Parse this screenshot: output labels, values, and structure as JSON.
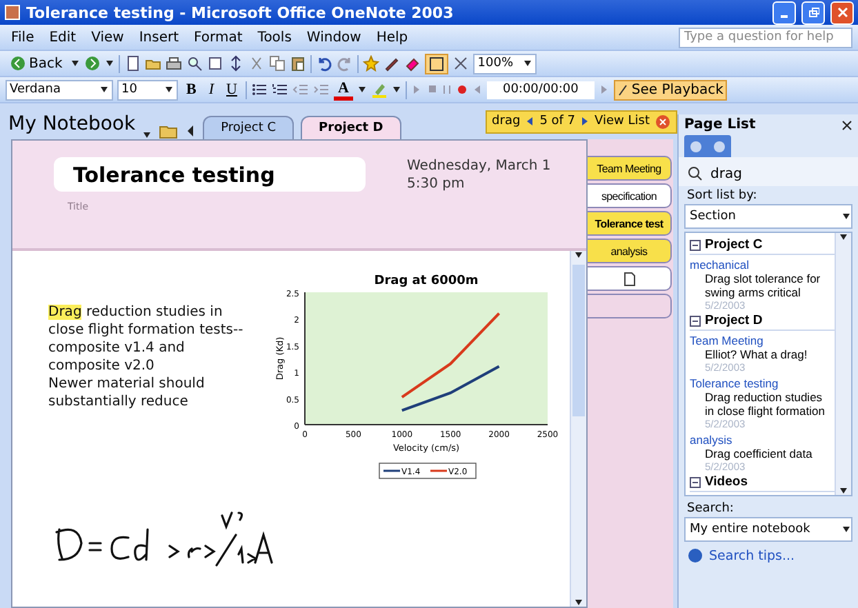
{
  "window": {
    "title": "Tolerance testing - Microsoft Office OneNote 2003"
  },
  "menu": [
    "File",
    "Edit",
    "View",
    "Insert",
    "Format",
    "Tools",
    "Window",
    "Help"
  ],
  "help_search": {
    "placeholder": "Type a question for help"
  },
  "standard_toolbar": {
    "back": "Back",
    "zoom": "100%"
  },
  "formatting_toolbar": {
    "font": "Verdana",
    "size": "10",
    "bold": "B",
    "italic": "I",
    "underline": "U",
    "font_color": "A"
  },
  "audio_toolbar": {
    "time": "00:00/00:00",
    "playback": "See Playback"
  },
  "notebook": {
    "title": "My Notebook"
  },
  "section_tabs": [
    {
      "label": "Project C",
      "selected": false
    },
    {
      "label": "Project D",
      "selected": true
    }
  ],
  "search_bar": {
    "term": "drag",
    "position": "5 of 7",
    "view_list": "View List"
  },
  "page": {
    "title": "Tolerance testing",
    "title_label": "Title",
    "date": "Wednesday, March 1",
    "time": "5:30 pm",
    "paragraphs": [
      {
        "highlight": "Drag",
        "text": " reduction studies in close flight formation tests--composite v1.4 and composite v2.0"
      },
      {
        "text": "Newer material should substantially reduce"
      }
    ],
    "chart_data": {
      "type": "line",
      "title": "Drag at 6000m",
      "xlabel": "Velocity (cm/s)",
      "ylabel": "Drag (Kd)",
      "x": [
        1000,
        1500,
        2000
      ],
      "legend": "bottom",
      "xlim": [
        0,
        2500
      ],
      "ylim": [
        0,
        2.5
      ],
      "xticks": [
        0,
        500,
        1000,
        1500,
        2000,
        2500
      ],
      "yticks": [
        {
          "value": 0,
          "label": "0"
        },
        {
          "value": 0.5,
          "label": "0.5"
        },
        {
          "value": 1,
          "label": "1"
        },
        {
          "value": 1.5,
          "label": "1.5"
        },
        {
          "value": 2,
          "label": "2"
        },
        {
          "value": 2.5,
          "label": "2.5"
        }
      ],
      "series": [
        {
          "name": "V1.4",
          "color": "#1f3f7a",
          "values": [
            0.27,
            0.6,
            1.1
          ]
        },
        {
          "name": "V2.0",
          "color": "#d83a1c",
          "values": [
            0.52,
            1.15,
            2.1
          ]
        }
      ]
    }
  },
  "page_tabs": [
    {
      "label": "Team Meeting",
      "selected": false,
      "match": true
    },
    {
      "label": "specification",
      "selected": false,
      "match": false
    },
    {
      "label": "Tolerance test",
      "selected": true,
      "match": true
    },
    {
      "label": "analysis",
      "selected": false,
      "match": true
    }
  ],
  "page_list": {
    "title": "Page List",
    "term": "drag",
    "sort_label": "Sort list by:",
    "sort_value": "Section",
    "groups": [
      {
        "name": "Project C",
        "results": [
          {
            "page": "mechanical",
            "snippet": "Drag slot tolerance for swing arms critical",
            "date": "5/2/2003"
          }
        ]
      },
      {
        "name": "Project D",
        "results": [
          {
            "page": "Team Meeting",
            "snippet": "Elliot? What a drag!",
            "date": "5/2/2003"
          },
          {
            "page": "Tolerance testing",
            "snippet": "Drag reduction studies in close flight formation",
            "date": "5/2/2003"
          },
          {
            "page": "analysis",
            "snippet": "Drag coefficient data",
            "date": "5/2/2003"
          }
        ]
      },
      {
        "name": "Videos"
      }
    ],
    "search_label": "Search:",
    "scope": "My entire notebook",
    "tips": "Search tips..."
  }
}
